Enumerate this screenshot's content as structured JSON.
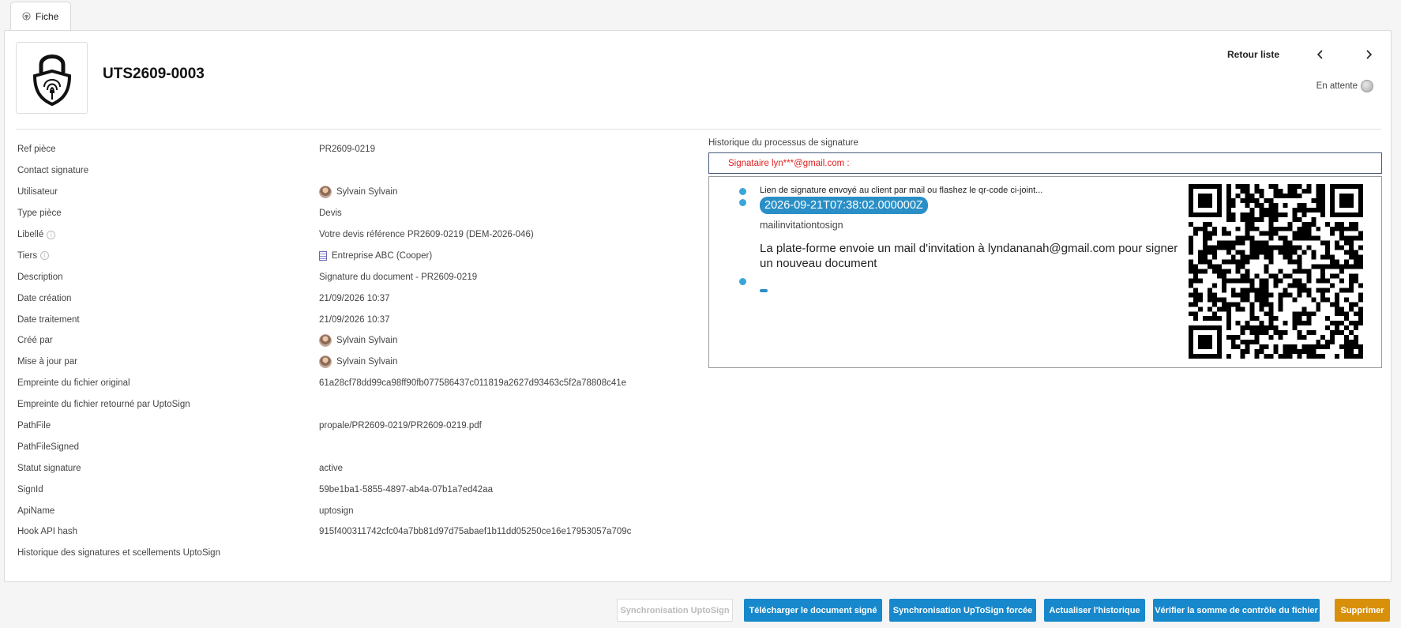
{
  "tabs": [
    {
      "label": "Fiche",
      "icon": "fingerprint-icon"
    }
  ],
  "header": {
    "ref": "UTS2609-0003",
    "back_label": "Retour liste",
    "status_label": "En attente",
    "prev_icon": "chevron-left-icon",
    "next_icon": "chevron-right-icon",
    "logo_icon": "padlock-fingerprint-logo"
  },
  "fields": [
    {
      "label": "Ref pièce",
      "value": "PR2609-0219"
    },
    {
      "label": "Contact signature",
      "value": ""
    },
    {
      "label": "Utilisateur",
      "value": "Sylvain Sylvain",
      "avatar": true
    },
    {
      "label": "Type pièce",
      "value": "Devis"
    },
    {
      "label": "Libellé",
      "value": "Votre devis référence PR2609-0219 (DEM-2026-046)",
      "info": true
    },
    {
      "label": "Tiers",
      "value": "Entreprise ABC (Cooper)",
      "info": true,
      "company": true
    },
    {
      "label": "Description",
      "value": "Signature du document - PR2609-0219"
    },
    {
      "label": "Date création",
      "value": "21/09/2026 10:37"
    },
    {
      "label": "Date traitement",
      "value": "21/09/2026 10:37"
    },
    {
      "label": "Créé par",
      "value": "Sylvain Sylvain",
      "avatar": true
    },
    {
      "label": "Mise à jour par",
      "value": "Sylvain Sylvain",
      "avatar": true
    },
    {
      "label": "Empreinte du fichier original",
      "value": "61a28cf78dd99ca98ff90fb077586437c011819a2627d93463c5f2a78808c41e"
    },
    {
      "label": "Empreinte du fichier retourné par UptoSign",
      "value": ""
    },
    {
      "label": "PathFile",
      "value": "propale/PR2609-0219/PR2609-0219.pdf"
    },
    {
      "label": "PathFileSigned",
      "value": ""
    },
    {
      "label": "Statut signature",
      "value": "active"
    },
    {
      "label": "SignId",
      "value": "59be1ba1-5855-4897-ab4a-07b1a7ed42aa"
    },
    {
      "label": "ApiName",
      "value": "uptosign"
    },
    {
      "label": "Hook API hash",
      "value": "915f400311742cfc04a7bb81d97d75abaef1b11dd05250ce16e17953057a709c"
    },
    {
      "label": "Historique des signatures et scellements UptoSign",
      "value": ""
    }
  ],
  "history": {
    "title": "Historique du processus de signature",
    "signer": "Signataire lyn***@gmail.com :",
    "event": {
      "note": "Lien de signature envoyé au client par mail ou flashez le qr-code ci-joint...",
      "date": "2026-09-21T07:38:02.000000Z",
      "code": "mailinvitationtosign",
      "message": "La plate-forme envoie un mail d'invitation à lyndananah@gmail.com pour signer un nouveau document"
    },
    "qr_icon": "qr-code-icon"
  },
  "actions": [
    {
      "label": "Synchronisation UptoSign",
      "disabled": true
    },
    {
      "label": "Télécharger le document signé"
    },
    {
      "label": "Synchronisation UpToSign forcée"
    },
    {
      "label": "Actualiser l'historique"
    },
    {
      "label": "Vérifier la somme de contrôle du fichier"
    },
    {
      "label": "Supprimer",
      "danger": true
    }
  ],
  "colors": {
    "primary_button": "#1888cc",
    "danger_button": "#d8900b",
    "timeline_accent": "#3aa5d9",
    "signer_text": "#e02020"
  }
}
